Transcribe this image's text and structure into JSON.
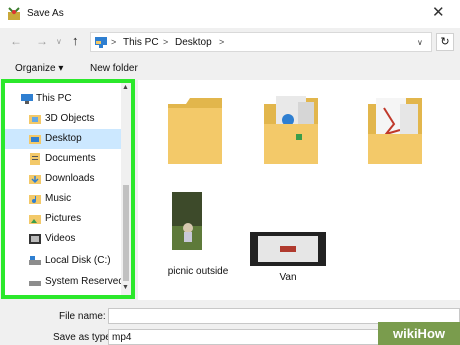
{
  "window": {
    "title": "Save As",
    "close": "✕"
  },
  "address": {
    "crumbs": [
      "This PC",
      "Desktop"
    ],
    "sep": ">",
    "dropdown": "∨",
    "refresh": "↻"
  },
  "toolbar": {
    "organize": "Organize ▾",
    "new_folder": "New folder"
  },
  "nav": {
    "items": [
      {
        "label": "This PC",
        "icon": "pc-icon"
      },
      {
        "label": "3D Objects",
        "icon": "3d-objects-icon"
      },
      {
        "label": "Desktop",
        "icon": "desktop-icon",
        "selected": true
      },
      {
        "label": "Documents",
        "icon": "documents-icon"
      },
      {
        "label": "Downloads",
        "icon": "downloads-icon"
      },
      {
        "label": "Music",
        "icon": "music-icon"
      },
      {
        "label": "Pictures",
        "icon": "pictures-icon"
      },
      {
        "label": "Videos",
        "icon": "videos-icon"
      },
      {
        "label": "Local Disk (C:)",
        "icon": "drive-icon"
      },
      {
        "label": "System Reserved",
        "icon": "drive-icon"
      }
    ]
  },
  "files": {
    "items": [
      {
        "label": "",
        "type": "folder"
      },
      {
        "label": "",
        "type": "folder-with-images"
      },
      {
        "label": "",
        "type": "folder-with-pdf"
      },
      {
        "label": "picnic outside",
        "type": "image"
      },
      {
        "label": "Van",
        "type": "video"
      }
    ]
  },
  "bottom": {
    "file_name_label": "File name:",
    "file_name_value": "",
    "save_as_type_label": "Save as type:",
    "save_as_type_value": "mp4"
  },
  "watermark": "wikiHow",
  "colors": {
    "highlight": "#2be82b",
    "selection": "#cce8ff",
    "folder": "#f3c969"
  }
}
